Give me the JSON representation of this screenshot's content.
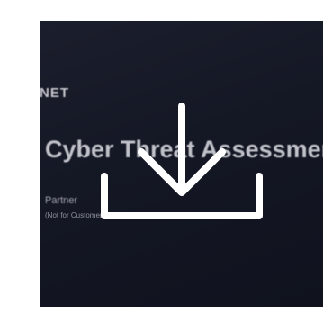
{
  "thumbnail": {
    "brand_text": "NET",
    "title": "Cyber Threat Assessment Program (CTAP)",
    "subtitle": "Partner",
    "note": "(Not for Customer Consumption)"
  },
  "download": {
    "icon": "download-icon",
    "color": "#ffffff"
  },
  "colors": {
    "page_background": "#ffffff",
    "slide_background": "#141724",
    "slide_text": "#dfe0e6"
  }
}
